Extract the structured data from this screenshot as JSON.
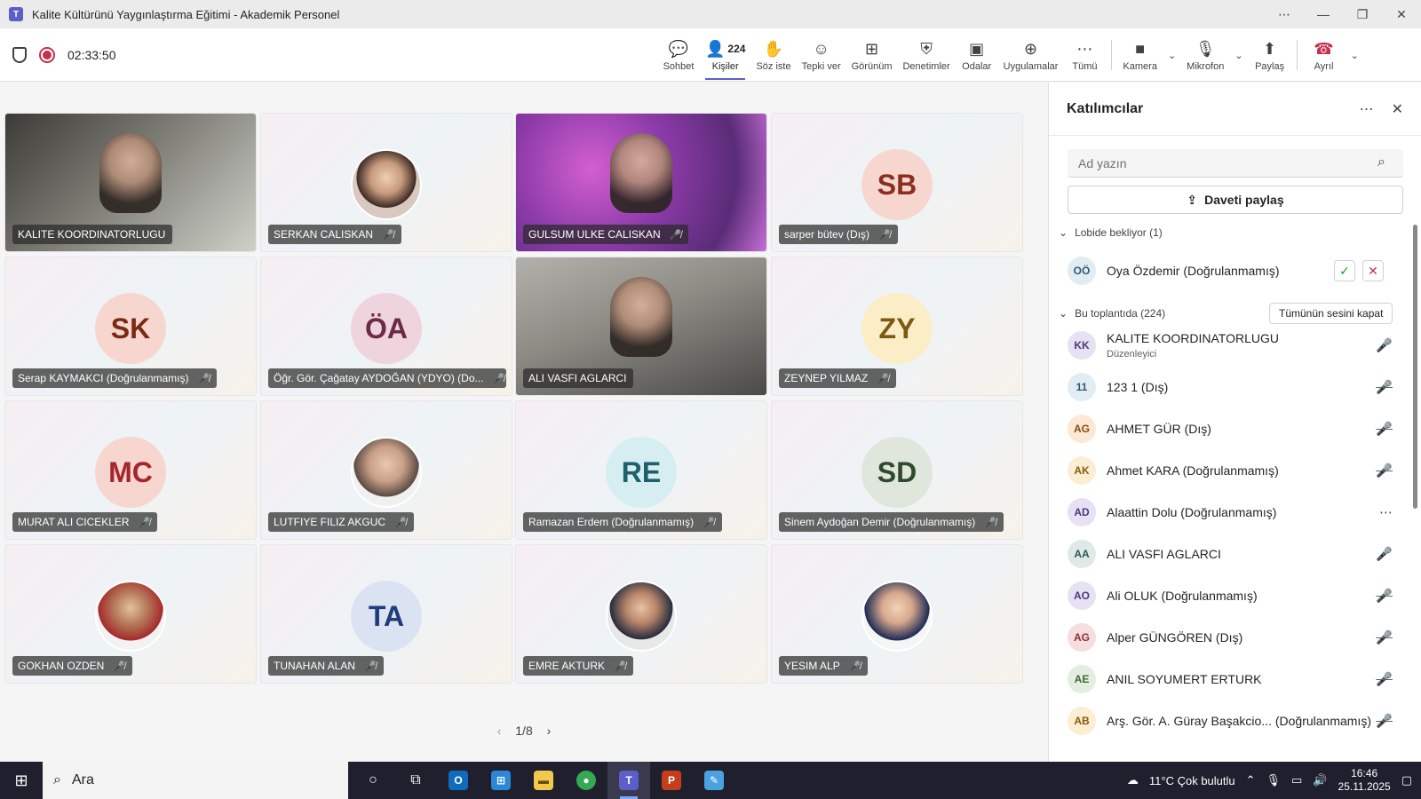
{
  "window": {
    "title": "Kalite Kültürünü Yaygınlaştırma Eğitimi - Akademik Personel"
  },
  "meeting": {
    "timer": "02:33:50"
  },
  "toolbar": {
    "chat": "Sohbet",
    "people": "Kişiler",
    "people_count": "224",
    "raise_hand": "Söz iste",
    "react": "Tepki ver",
    "view": "Görünüm",
    "controls": "Denetimler",
    "rooms": "Odalar",
    "apps": "Uygulamalar",
    "more": "Tümü",
    "camera": "Kamera",
    "mic": "Mikrofon",
    "share": "Paylaş",
    "leave": "Ayrıl"
  },
  "tiles": [
    {
      "name": "KALITE KOORDINATORLUGU",
      "initials": "",
      "muted": false
    },
    {
      "name": "SERKAN CALISKAN",
      "initials": "",
      "muted": true
    },
    {
      "name": "GULSUM ULKE CALISKAN",
      "initials": "",
      "muted": true
    },
    {
      "name": "sarper bütev (Dış)",
      "initials": "SB",
      "muted": true
    },
    {
      "name": "Serap KAYMAKCI (Doğrulanmamış)",
      "initials": "SK",
      "muted": true
    },
    {
      "name": "Öğr. Gör. Çağatay AYDOĞAN (YDYO) (Do...",
      "initials": "ÖA",
      "muted": true
    },
    {
      "name": "ALI VASFI AGLARCI",
      "initials": "",
      "muted": false
    },
    {
      "name": "ZEYNEP YILMAZ",
      "initials": "ZY",
      "muted": true
    },
    {
      "name": "MURAT ALI CICEKLER",
      "initials": "MC",
      "muted": true
    },
    {
      "name": "LUTFIYE FILIZ AKGUC",
      "initials": "",
      "muted": true
    },
    {
      "name": "Ramazan Erdem (Doğrulanmamış)",
      "initials": "RE",
      "muted": true
    },
    {
      "name": "Sinem Aydoğan Demir (Doğrulanmamış)",
      "initials": "SD",
      "muted": true
    },
    {
      "name": "GOKHAN OZDEN",
      "initials": "",
      "muted": true
    },
    {
      "name": "TUNAHAN ALAN",
      "initials": "TA",
      "muted": true
    },
    {
      "name": "EMRE AKTURK",
      "initials": "",
      "muted": true
    },
    {
      "name": "YESIM ALP",
      "initials": "",
      "muted": true
    }
  ],
  "pager": {
    "label": "1/8"
  },
  "panel": {
    "title": "Katılımcılar",
    "search_placeholder": "Ad yazın",
    "share_invite": "Daveti paylaş",
    "lobby_section": "Lobide bekliyor (1)",
    "meeting_section": "Bu toplantıda (224)",
    "mute_all": "Tümünün sesini kapat",
    "lobby": [
      {
        "initials": "OÖ",
        "name": "Oya Özdemir (Doğrulanmamış)"
      }
    ],
    "participants": [
      {
        "initials": "KK",
        "name": "KALITE KOORDINATORLUGU",
        "role": "Düzenleyici",
        "status": "mic-on"
      },
      {
        "initials": "11",
        "name": "123 1 (Dış)",
        "role": "",
        "status": "mic-off"
      },
      {
        "initials": "AG",
        "name": "AHMET GÜR (Dış)",
        "role": "",
        "status": "mic-off"
      },
      {
        "initials": "AK",
        "name": "Ahmet KARA (Doğrulanmamış)",
        "role": "",
        "status": "mic-off"
      },
      {
        "initials": "AD",
        "name": "Alaattin Dolu (Doğrulanmamış)",
        "role": "",
        "status": "more"
      },
      {
        "initials": "AA",
        "name": "ALI VASFI AGLARCI",
        "role": "",
        "status": "mic-on"
      },
      {
        "initials": "AO",
        "name": "Ali OLUK (Doğrulanmamış)",
        "role": "",
        "status": "mic-off"
      },
      {
        "initials": "AG",
        "name": "Alper GÜNGÖREN (Dış)",
        "role": "",
        "status": "mic-off"
      },
      {
        "initials": "AE",
        "name": "ANIL SOYUMERT ERTURK",
        "role": "",
        "status": "mic-off"
      },
      {
        "initials": "AB",
        "name": "Arş. Gör. A. Güray Başakcio...  (Doğrulanmamış)",
        "role": "",
        "status": "mic-off"
      }
    ]
  },
  "taskbar": {
    "search_label": "Ara",
    "weather": "11°C  Çok bulutlu",
    "time": "16:46",
    "date": "25.11.2025"
  },
  "colors": {
    "accent": "#5b5fc7",
    "hangup": "#c4314b",
    "accept": "#13a10e"
  }
}
